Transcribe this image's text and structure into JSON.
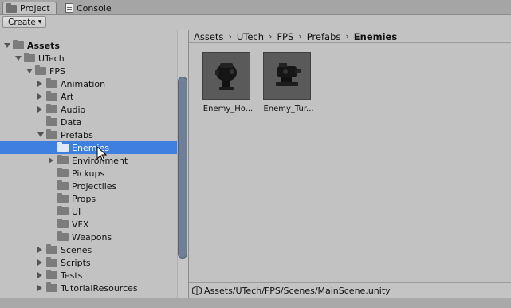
{
  "tabs": [
    {
      "label": "Project",
      "icon": "folder-icon",
      "active": true
    },
    {
      "label": "Console",
      "icon": "console-icon",
      "active": false
    }
  ],
  "toolbar": {
    "create_label": "Create"
  },
  "tree": [
    {
      "label": "Assets",
      "bold": true,
      "expanded": true,
      "depth": 0
    },
    {
      "label": "UTech",
      "expanded": true,
      "depth": 1
    },
    {
      "label": "FPS",
      "expanded": true,
      "depth": 2
    },
    {
      "label": "Animation",
      "expanded": false,
      "depth": 3
    },
    {
      "label": "Art",
      "expanded": false,
      "depth": 3
    },
    {
      "label": "Audio",
      "expanded": false,
      "depth": 3
    },
    {
      "label": "Data",
      "expanded": null,
      "depth": 3
    },
    {
      "label": "Prefabs",
      "expanded": true,
      "depth": 3
    },
    {
      "label": "Enemies",
      "selected": true,
      "expanded": null,
      "depth": 4
    },
    {
      "label": "Environment",
      "expanded": false,
      "depth": 4
    },
    {
      "label": "Pickups",
      "expanded": null,
      "depth": 4
    },
    {
      "label": "Projectiles",
      "expanded": null,
      "depth": 4
    },
    {
      "label": "Props",
      "expanded": null,
      "depth": 4
    },
    {
      "label": "UI",
      "expanded": null,
      "depth": 4
    },
    {
      "label": "VFX",
      "expanded": null,
      "depth": 4
    },
    {
      "label": "Weapons",
      "expanded": null,
      "depth": 4
    },
    {
      "label": "Scenes",
      "expanded": false,
      "depth": 3
    },
    {
      "label": "Scripts",
      "expanded": false,
      "depth": 3
    },
    {
      "label": "Tests",
      "expanded": false,
      "depth": 3
    },
    {
      "label": "TutorialResources",
      "expanded": false,
      "depth": 3
    }
  ],
  "breadcrumb": [
    "Assets",
    "UTech",
    "FPS",
    "Prefabs",
    "Enemies"
  ],
  "assets": [
    {
      "label": "Enemy_Ho...",
      "icon": "hover-bot-icon"
    },
    {
      "label": "Enemy_Tur...",
      "icon": "turret-icon"
    }
  ],
  "status": {
    "path": "Assets/UTech/FPS/Scenes/MainScene.unity",
    "icon": "unity-scene-icon"
  },
  "colors": {
    "selection": "#3d80df",
    "panel": "#c2c2c2",
    "scroll_thumb": "#6f7f95"
  }
}
